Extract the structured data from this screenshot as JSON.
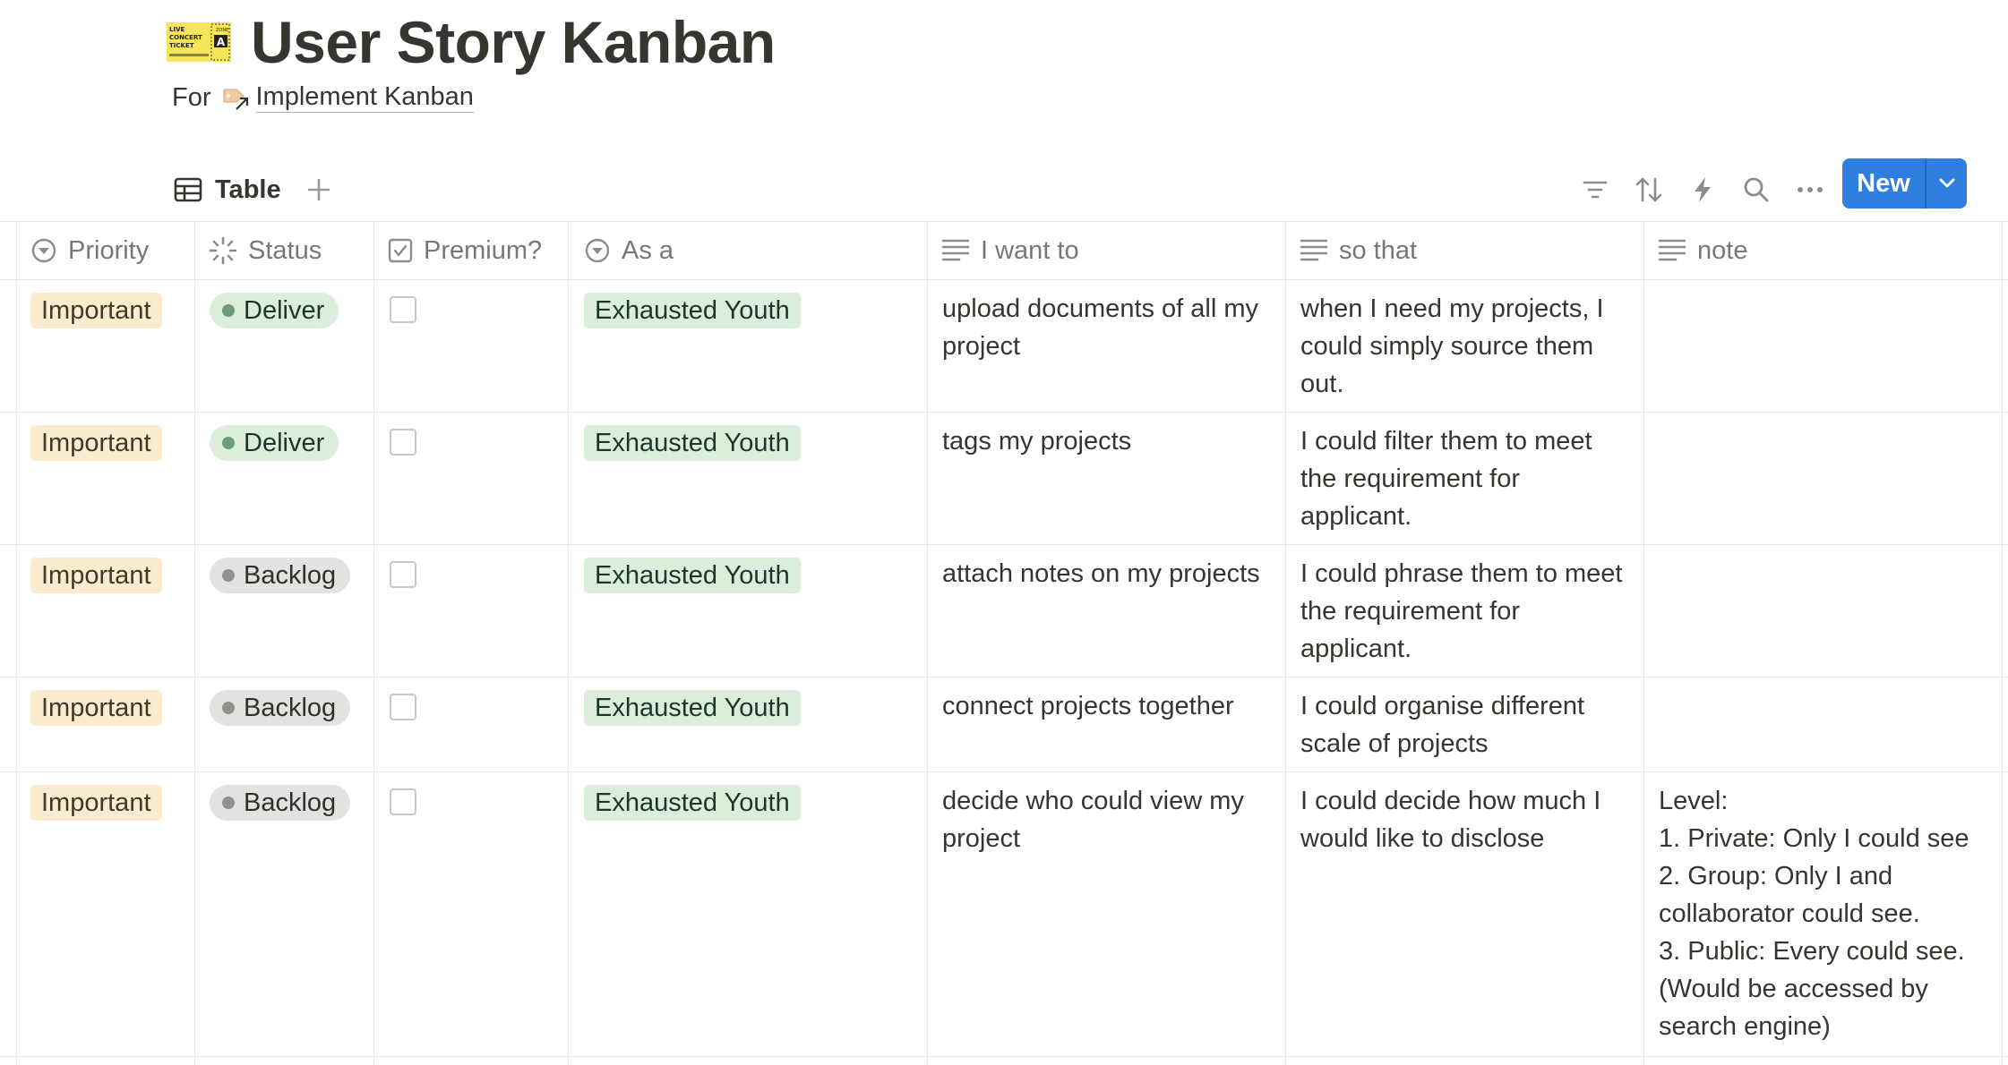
{
  "page": {
    "title": "User Story Kanban",
    "for_label": "For",
    "relation_link": "Implement Kanban",
    "icon": "concert-ticket-icon",
    "ticket_text": [
      "LIVE",
      "CONCERT",
      "TICKET",
      "ZONE",
      "A"
    ]
  },
  "toolbar": {
    "view_tab_label": "Table",
    "new_button_label": "New",
    "icons": [
      "filter-icon",
      "sort-icon",
      "automation-bolt-icon",
      "search-icon",
      "more-icon"
    ]
  },
  "columns": [
    {
      "label": "Priority",
      "icon": "select-icon"
    },
    {
      "label": "Status",
      "icon": "status-icon"
    },
    {
      "label": "Premium?",
      "icon": "checkbox-icon"
    },
    {
      "label": "As a",
      "icon": "select-icon"
    },
    {
      "label": "I want to",
      "icon": "text-icon"
    },
    {
      "label": "so that",
      "icon": "text-icon"
    },
    {
      "label": "note",
      "icon": "text-icon"
    }
  ],
  "rows": [
    {
      "priority": "Important",
      "status": "Deliver",
      "premium": false,
      "as_a": "Exhausted Youth",
      "want": "upload documents of all my\nproject",
      "so_that": "when I need my projects, I\ncould simply source them\nout.",
      "note": ""
    },
    {
      "priority": "Important",
      "status": "Deliver",
      "premium": false,
      "as_a": "Exhausted Youth",
      "want": "tags my projects",
      "so_that": "I could filter them to meet\nthe requirement for\napplicant.",
      "note": ""
    },
    {
      "priority": "Important",
      "status": "Backlog",
      "premium": false,
      "as_a": "Exhausted Youth",
      "want": "attach notes on my projects",
      "so_that": "I could phrase them to meet\nthe requirement for\napplicant.",
      "note": ""
    },
    {
      "priority": "Important",
      "status": "Backlog",
      "premium": false,
      "as_a": "Exhausted Youth",
      "want": "connect projects together",
      "so_that": "I could organise different\nscale of projects",
      "note": ""
    },
    {
      "priority": "Important",
      "status": "Backlog",
      "premium": false,
      "as_a": "Exhausted Youth",
      "want": "decide who could view my\nproject",
      "so_that": "I could decide how much I\nwould like to disclose",
      "note": "Level:\n1. Private: Only I could see\n2. Group: Only I and\ncollaborator could see.\n3. Public: Every could see.\n(Would be accessed by\nsearch engine)"
    }
  ],
  "colors": {
    "accent": "#2e7fe0",
    "important_tag_bg": "#fbecd0",
    "youth_tag_bg": "#dbeddb",
    "deliver_bg": "#dbeddb",
    "backlog_bg": "#e3e2e0"
  }
}
